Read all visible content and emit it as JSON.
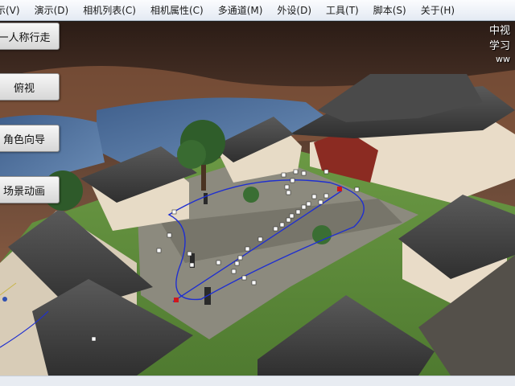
{
  "menu": {
    "items": [
      {
        "label": "示(V)"
      },
      {
        "label": "演示(D)"
      },
      {
        "label": "相机列表(C)"
      },
      {
        "label": "相机属性(C)"
      },
      {
        "label": "多通道(M)"
      },
      {
        "label": "外设(D)"
      },
      {
        "label": "工具(T)"
      },
      {
        "label": "脚本(S)"
      },
      {
        "label": "关于(H)"
      }
    ]
  },
  "side_panel": {
    "buttons": [
      {
        "label": "一人称行走"
      },
      {
        "label": "俯视"
      },
      {
        "label": "角色向导"
      },
      {
        "label": "场景动画"
      }
    ]
  },
  "overlay": {
    "line1": "中视",
    "line2": "学习",
    "line3": "ww"
  },
  "colors": {
    "path_curve": "#1f2fd0",
    "control_point": "#ffffff",
    "selected_point": "#d0181c"
  }
}
